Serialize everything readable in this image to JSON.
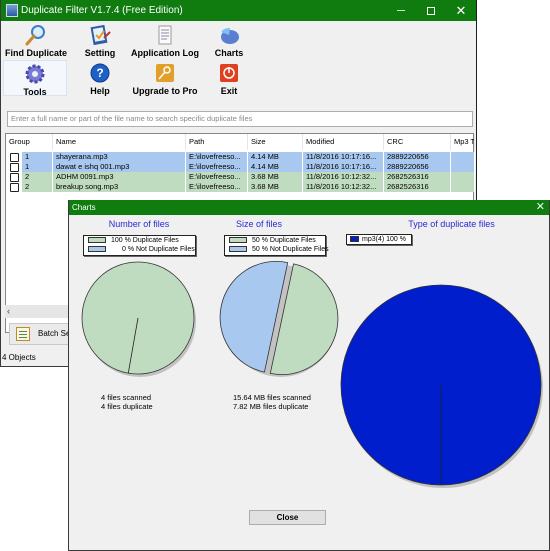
{
  "main_window": {
    "title": "Duplicate Filter  V1.7.4 (Free Edition)",
    "controls": {
      "minimize": "minimize",
      "maximize": "maximize",
      "close": "close"
    },
    "toolbar": [
      {
        "label": "Find Duplicate",
        "icon": "magnifier-icon"
      },
      {
        "label": "Setting",
        "icon": "settings-clipboard-icon"
      },
      {
        "label": "Application Log",
        "icon": "log-document-icon"
      },
      {
        "label": "Charts",
        "icon": "pie-chart-icon"
      },
      {
        "label": "Tools",
        "icon": "gear-icon"
      },
      {
        "label": "Help",
        "icon": "help-icon"
      },
      {
        "label": "Upgrade to Pro",
        "icon": "key-icon"
      },
      {
        "label": "Exit",
        "icon": "power-icon"
      }
    ],
    "search": {
      "placeholder": "Enter a full name or part of the file name to search specific duplicate files",
      "value": ""
    },
    "grid": {
      "columns": [
        "Group",
        "Name",
        "Path",
        "Size",
        "Modified",
        "CRC",
        "Mp3 T"
      ],
      "rows": [
        {
          "group": "1",
          "name": "shayerana.mp3",
          "path": "E:\\ilovefreeso...",
          "size": "4.14 MB",
          "modified": "11/8/2016 10:17:16...",
          "crc": "2889220656",
          "mp3": "",
          "color": "blue",
          "checked": false
        },
        {
          "group": "1",
          "name": "dawat e ishq 001.mp3",
          "path": "E:\\ilovefreeso...",
          "size": "4.14 MB",
          "modified": "11/8/2016 10:17:16...",
          "crc": "2889220656",
          "mp3": "",
          "color": "blue",
          "checked": false
        },
        {
          "group": "2",
          "name": "ADHM 0091.mp3",
          "path": "E:\\ilovefreeso...",
          "size": "3.68 MB",
          "modified": "11/8/2016 10:12:32...",
          "crc": "2682526316",
          "mp3": "",
          "color": "green",
          "checked": false
        },
        {
          "group": "2",
          "name": "breakup song.mp3",
          "path": "E:\\ilovefreeso...",
          "size": "3.68 MB",
          "modified": "11/8/2016 10:12:32...",
          "crc": "2682526316",
          "mp3": "",
          "color": "green",
          "checked": false
        }
      ]
    },
    "batch_button": "Batch Sele",
    "status": "4 Objects"
  },
  "charts_dialog": {
    "title": "Charts",
    "close_label": "Close",
    "number_of_files": {
      "title": "Number of files",
      "legend": [
        "100 % Duplicate Files",
        "0 % Not Duplicate Files"
      ],
      "stats": [
        "4 files scanned",
        "4 files duplicate"
      ]
    },
    "size_of_files": {
      "title": "Size of files",
      "legend": [
        "50 % Duplicate Files",
        "50 % Not Duplicate Files"
      ],
      "stats": [
        "15.64 MB files scanned",
        "7.82 MB files duplicate"
      ]
    },
    "type_of_files": {
      "title": "Type of duplicate files",
      "legend": [
        "mp3(4)  100 %"
      ]
    }
  },
  "colors": {
    "titlebar": "#107c10",
    "duplicate": "#c0dcc0",
    "not_duplicate": "#a8c8f0",
    "mp3": "#001ecc",
    "chart_title": "#2a2ad0"
  },
  "chart_data": [
    {
      "type": "pie",
      "title": "Number of files",
      "categories": [
        "Duplicate Files",
        "Not Duplicate Files"
      ],
      "values": [
        100,
        0
      ],
      "unit": "%"
    },
    {
      "type": "pie",
      "title": "Size of files",
      "categories": [
        "Duplicate Files",
        "Not Duplicate Files"
      ],
      "values": [
        50,
        50
      ],
      "unit": "%"
    },
    {
      "type": "pie",
      "title": "Type of duplicate files",
      "categories": [
        "mp3(4)"
      ],
      "values": [
        100
      ],
      "unit": "%"
    }
  ]
}
